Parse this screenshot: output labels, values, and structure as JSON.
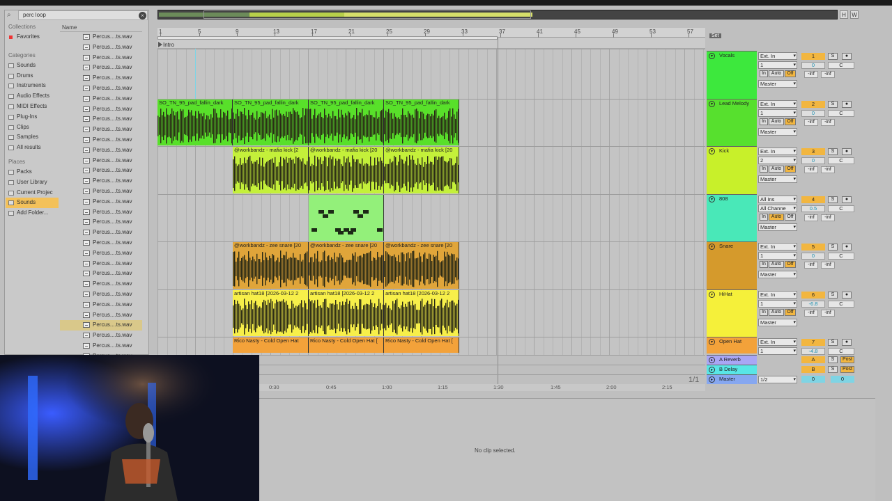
{
  "browser": {
    "search_value": "perc loop",
    "collections_header": "Collections",
    "favorites": "Favorites",
    "categories_header": "Categories",
    "categories": [
      "Sounds",
      "Drums",
      "Instruments",
      "Audio Effects",
      "MIDI Effects",
      "Plug-Ins",
      "Clips",
      "Samples",
      "All results"
    ],
    "places_header": "Places",
    "places": [
      "Packs",
      "User Library",
      "Current Projec",
      "Sounds",
      "Add Folder..."
    ],
    "name_column": "Name",
    "file_name": "Percus....ts.wav",
    "file_count": 32,
    "selected_file_index": 28
  },
  "overview": {
    "h_label": "H",
    "w_label": "W"
  },
  "ruler": {
    "bars": [
      "1",
      "5",
      "9",
      "13",
      "17",
      "21",
      "25",
      "29",
      "33",
      "37",
      "41",
      "45",
      "49",
      "53",
      "57"
    ]
  },
  "locator": {
    "name": "Intro"
  },
  "set_label": "Set",
  "clips": {
    "lead": [
      "SO_TN_95_pad_fallin_dark",
      "SO_TN_95_pad_fallin_dark",
      "SO_TN_95_pad_fallin_dark",
      "SO_TN_95_pad_fallin_dark"
    ],
    "kick": [
      "@workbandz - mafia kick [2",
      "@workbandz - mafia kick [20",
      "@workbandz - mafia kick [20"
    ],
    "snare": [
      "@workbandz - zee snare [20",
      "@workbandz - zee snare [20",
      "@workbandz - zee snare [20"
    ],
    "hihat": [
      "artisan hat18 [2026-03-12 2",
      "artisan hat18 [2026-03-12 2",
      "artisan hat18 [2026-03-12 2"
    ],
    "openhat": [
      "Rico Nasty - Cold Open Hat",
      "Rico Nasty - Cold Open Hat [",
      "Rico Nasty - Cold Open Hat ["
    ]
  },
  "tracks": [
    {
      "name": "Vocals",
      "color": "#3de83d",
      "input": "Ext. In",
      "channel": "1",
      "num": "1",
      "vol": "0",
      "pan": "C",
      "in": "In",
      "auto": "Auto",
      "off": "Off",
      "out": "Master",
      "inf1": "-inf",
      "inf2": "-inf"
    },
    {
      "name": "Lead Melody",
      "color": "#57e02e",
      "input": "Ext. In",
      "channel": "1",
      "num": "2",
      "vol": "0",
      "pan": "C",
      "in": "In",
      "auto": "Auto",
      "off": "Off",
      "out": "Master",
      "inf1": "-inf",
      "inf2": "-inf"
    },
    {
      "name": "Kick",
      "color": "#c8f02a",
      "input": "Ext. In",
      "channel": "2",
      "num": "3",
      "vol": "0",
      "pan": "C",
      "in": "In",
      "auto": "Auto",
      "off": "Off",
      "out": "Master",
      "inf1": "-inf",
      "inf2": "-inf"
    },
    {
      "name": "808",
      "color": "#49e8b8",
      "input": "All Ins",
      "channel": "All Channe",
      "num": "4",
      "vol": "0.5",
      "pan": "C",
      "in": "In",
      "auto": "Auto",
      "off": "Off",
      "out": "Master",
      "inf1": "-inf",
      "inf2": "-inf"
    },
    {
      "name": "Snare",
      "color": "#d59a2c",
      "input": "Ext. In",
      "channel": "1",
      "num": "5",
      "vol": "0",
      "pan": "C",
      "in": "In",
      "auto": "Auto",
      "off": "Off",
      "out": "Master",
      "inf1": "-inf",
      "inf2": "-inf"
    },
    {
      "name": "HiHat",
      "color": "#f5f03a",
      "input": "Ext. In",
      "channel": "1",
      "num": "6",
      "vol": "-6.8",
      "pan": "C",
      "in": "In",
      "auto": "Auto",
      "off": "Off",
      "out": "Master",
      "inf1": "-inf",
      "inf2": "-inf"
    },
    {
      "name": "Open Hat",
      "color": "#f3a23a",
      "input": "Ext. In",
      "channel": "1",
      "num": "7",
      "vol": "-4.8",
      "pan": "C"
    }
  ],
  "returns": [
    {
      "name": "A Reverb",
      "color": "#a9a6f5",
      "letter": "A",
      "post": "Post"
    },
    {
      "name": "B Delay",
      "color": "#58e6e6",
      "letter": "B",
      "post": "Post"
    }
  ],
  "master": {
    "name": "Master",
    "color": "#86a7f0",
    "route": "1/2",
    "vol": "0",
    "pan": "0"
  },
  "time_labels": [
    "0:30",
    "0:45",
    "1:00",
    "1:15",
    "1:30",
    "1:45",
    "2:00",
    "2:15"
  ],
  "page_fraction": "1/1",
  "detail": {
    "message": "No clip selected."
  },
  "colors": {
    "lead": "#58e02a",
    "kick": "#c4f03a",
    "808": "#93f07a",
    "snare": "#e0a53a",
    "hihat": "#f7ef4a",
    "openhat": "#f3a23a"
  }
}
